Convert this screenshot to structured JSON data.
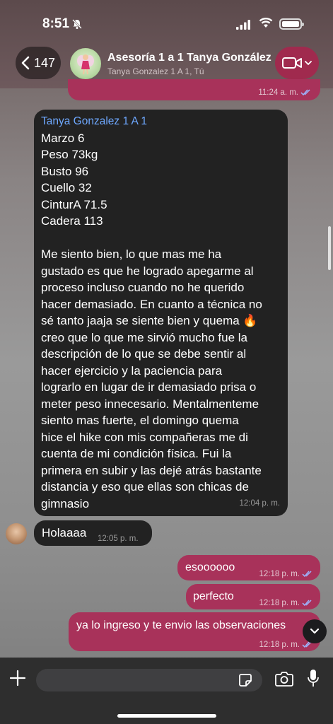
{
  "status_bar": {
    "time": "8:51"
  },
  "header": {
    "back_count": "147",
    "title": "Asesoría 1 a 1 Tanya González",
    "subtitle": "Tanya Gonzalez 1 A 1, Tú"
  },
  "messages": [
    {
      "type": "out",
      "text": "",
      "time": "11:24 a. m."
    },
    {
      "type": "in",
      "sender": "Tanya Gonzalez 1 A 1",
      "text": "Marzo 6\nPeso 73kg\nBusto 96\nCuello 32\nCinturA 71.5\nCadera 113\n\nMe siento bien, lo que mas me ha\ngustado es que he logrado apegarme al\nproceso incluso cuando no he querido\nhacer demasiado. En cuanto a técnica no\nsé tanto jaaja se siente bien y quema 🔥\ncreo que lo que me sirvió mucho fue la\ndescripción de lo que se debe sentir al\nhacer ejercicio y la paciencia para\nlograrlo en lugar de ir demasiado prisa o\nmeter peso innecesario. Mentalmenteme\nsiento mas fuerte, el domingo quema\nhice el hike con mis compañeras me di\ncuenta de mi condición física. Fui la\nprimera en subir y las dejé atrás bastante\ndistancia y eso que ellas son chicas de\ngimnasio",
      "time": "12:04 p. m."
    },
    {
      "type": "in",
      "text": "Holaaaa",
      "time": "12:05 p. m."
    },
    {
      "type": "out",
      "text": "esoooooo",
      "time": "12:18 p. m."
    },
    {
      "type": "out",
      "text": "perfecto",
      "time": "12:18 p. m."
    },
    {
      "type": "out",
      "text": "ya lo ingreso y te envio las observaciones",
      "time": "12:18 p. m."
    }
  ],
  "composer": {
    "placeholder": ""
  },
  "colors": {
    "outgoing_bubble": "#a8325a",
    "incoming_bubble": "#222222",
    "sender_name": "#6ea8ff",
    "read_ticks": "#9db5ff"
  },
  "icons": [
    "mute-bell-icon",
    "cellular-signal-icon",
    "wifi-icon",
    "battery-icon",
    "chevron-left-icon",
    "video-call-icon",
    "chevron-down-icon",
    "double-check-icon",
    "plus-icon",
    "sticker-icon",
    "camera-icon",
    "microphone-icon"
  ]
}
